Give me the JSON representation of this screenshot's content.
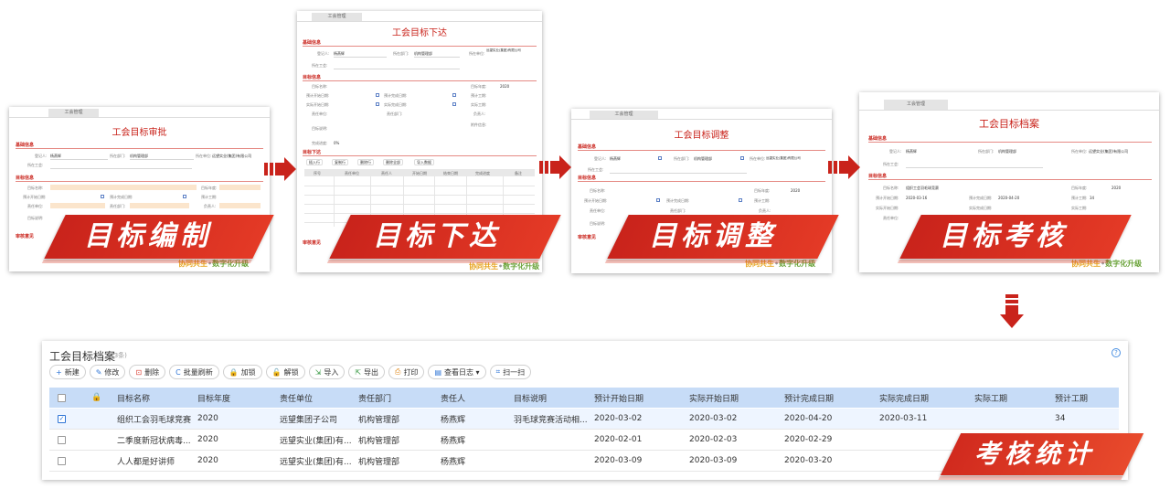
{
  "flow": [
    {
      "title": "工会目标审批",
      "tab": "工会管理",
      "sections": [
        "基础信息",
        "目标信息",
        "审核意见"
      ],
      "fields": [
        {
          "label": "登记人:",
          "value": "杨燕辉"
        },
        {
          "label": "所在部门:",
          "value": "机构管理部"
        },
        {
          "label": "所在单位:",
          "value": "远望实业(集团)有限公司"
        },
        {
          "label": "所在工会:",
          "value": ""
        },
        {
          "label": "目标名称:",
          "value": ""
        },
        {
          "label": "目标年度:",
          "value": ""
        },
        {
          "label": "预计开始日期:",
          "value": ""
        },
        {
          "label": "预计完成日期:",
          "value": ""
        },
        {
          "label": "预计工期:",
          "value": ""
        },
        {
          "label": "责任单位:",
          "value": ""
        },
        {
          "label": "责任部门:",
          "value": ""
        },
        {
          "label": "负责人:",
          "value": ""
        },
        {
          "label": "目标说明:",
          "value": ""
        }
      ],
      "banner": "目标编制"
    },
    {
      "title": "工会目标下达",
      "tab": "工会管理",
      "sections": [
        "基础信息",
        "目标信息",
        "目标下达",
        "审核意见"
      ],
      "fields": [
        {
          "label": "登记人:",
          "value": "杨燕辉"
        },
        {
          "label": "所在部门:",
          "value": "机构管理部"
        },
        {
          "label": "所在单位:",
          "value": "远望实业(集团)有限公司"
        },
        {
          "label": "所在工会:",
          "value": ""
        },
        {
          "label": "目标名称:",
          "value": ""
        },
        {
          "label": "目标年度:",
          "value": "2020"
        },
        {
          "label": "预计开始日期:",
          "value": ""
        },
        {
          "label": "预计完成日期:",
          "value": ""
        },
        {
          "label": "预计工期:",
          "value": ""
        },
        {
          "label": "实际开始日期:",
          "value": ""
        },
        {
          "label": "实际完成日期:",
          "value": ""
        },
        {
          "label": "实际工期:",
          "value": ""
        },
        {
          "label": "责任单位:",
          "value": ""
        },
        {
          "label": "责任部门:",
          "value": ""
        },
        {
          "label": "负责人:",
          "value": ""
        },
        {
          "label": "目标说明:",
          "value": ""
        },
        {
          "label": "附件信息:",
          "value": ""
        },
        {
          "label": "完成进度:",
          "value": "0%"
        }
      ],
      "subtable_buttons": [
        "插入行",
        "复制行",
        "删除行",
        "删除全部",
        "导入数据"
      ],
      "subtable_headers": [
        "序号",
        "责任单位",
        "责任人",
        "开始日期",
        "结束日期",
        "完成进度",
        "备注"
      ],
      "banner": "目标下达"
    },
    {
      "title": "工会目标调整",
      "tab": "工会管理",
      "sections": [
        "基础信息",
        "目标信息",
        "审核意见"
      ],
      "fields": [
        {
          "label": "登记人:",
          "value": "杨燕辉"
        },
        {
          "label": "所在部门:",
          "value": "机构管理部"
        },
        {
          "label": "所在单位:",
          "value": "远望实业(集团)有限公司"
        },
        {
          "label": "所在工会:",
          "value": ""
        },
        {
          "label": "目标名称:",
          "value": ""
        },
        {
          "label": "目标年度:",
          "value": "2020"
        },
        {
          "label": "预计开始日期:",
          "value": ""
        },
        {
          "label": "预计完成日期:",
          "value": ""
        },
        {
          "label": "预计工期:",
          "value": ""
        },
        {
          "label": "责任单位:",
          "value": ""
        },
        {
          "label": "责任部门:",
          "value": ""
        },
        {
          "label": "负责人:",
          "value": ""
        },
        {
          "label": "目标说明:",
          "value": ""
        }
      ],
      "banner": "目标调整"
    },
    {
      "title": "工会目标档案",
      "tab": "工会管理",
      "sections": [
        "基础信息",
        "目标信息"
      ],
      "fields": [
        {
          "label": "登记人:",
          "value": "杨燕辉"
        },
        {
          "label": "所在部门:",
          "value": "机构管理部"
        },
        {
          "label": "所在单位:",
          "value": "远望实业(集团)有限公司"
        },
        {
          "label": "所在工会:",
          "value": ""
        },
        {
          "label": "目标名称:",
          "value": "组织工会羽毛球竞赛"
        },
        {
          "label": "目标年度:",
          "value": "2020"
        },
        {
          "label": "预计开始日期:",
          "value": "2020-03-16"
        },
        {
          "label": "预计完成日期:",
          "value": "2020-04-20"
        },
        {
          "label": "预计工期:",
          "value": "34"
        },
        {
          "label": "实际开始日期:",
          "value": ""
        },
        {
          "label": "实际完成日期:",
          "value": ""
        },
        {
          "label": "实际工期:",
          "value": ""
        },
        {
          "label": "责任单位:",
          "value": ""
        },
        {
          "label": "责任部门:",
          "value": ""
        },
        {
          "label": "负责人:",
          "value": ""
        }
      ],
      "banner": "目标考核"
    }
  ],
  "slogan": {
    "part1": "协同共生",
    "sep": "•",
    "part2": "数字化升级"
  },
  "archive": {
    "title": "工会目标档案",
    "count": "(3条)",
    "help": "?",
    "toolbar": [
      {
        "icon": "+",
        "label": "新建"
      },
      {
        "icon": "✎",
        "label": "修改"
      },
      {
        "icon": "⊡",
        "label": "删除"
      },
      {
        "icon": "C",
        "label": "批量刷新"
      },
      {
        "icon": "🔒",
        "label": "加锁"
      },
      {
        "icon": "🔓",
        "label": "解锁"
      },
      {
        "icon": "⇲",
        "label": "导入"
      },
      {
        "icon": "⇱",
        "label": "导出"
      },
      {
        "icon": "⎙",
        "label": "打印"
      },
      {
        "icon": "▤",
        "label": "查看日志 ▾"
      },
      {
        "icon": "⌗",
        "label": "扫一扫"
      }
    ],
    "columns": [
      "",
      "",
      "目标名称",
      "目标年度",
      "责任单位",
      "责任部门",
      "责任人",
      "目标说明",
      "预计开始日期",
      "实际开始日期",
      "预计完成日期",
      "实际完成日期",
      "实际工期",
      "预计工期"
    ],
    "rows": [
      {
        "checked": true,
        "name": "组织工会羽毛球竞赛",
        "year": "2020",
        "unit": "远望集团子公司",
        "dept": "机构管理部",
        "owner": "杨燕辉",
        "desc": "羽毛球竞赛活动相...",
        "plan_start": "2020-03-02",
        "actual_start": "2020-03-02",
        "plan_end": "2020-04-20",
        "actual_end": "2020-03-11",
        "actual_days": "",
        "plan_days": "34"
      },
      {
        "checked": false,
        "name": "二季度新冠状病毒...",
        "year": "2020",
        "unit": "远望实业(集团)有...",
        "dept": "机构管理部",
        "owner": "杨燕辉",
        "desc": "",
        "plan_start": "2020-02-01",
        "actual_start": "2020-02-03",
        "plan_end": "2020-02-29",
        "actual_end": "",
        "actual_days": "",
        "plan_days": ""
      },
      {
        "checked": false,
        "name": "人人都是好讲师",
        "year": "2020",
        "unit": "远望实业(集团)有...",
        "dept": "机构管理部",
        "owner": "杨燕辉",
        "desc": "",
        "plan_start": "2020-03-09",
        "actual_start": "2020-03-09",
        "plan_end": "2020-03-20",
        "actual_end": "",
        "actual_days": "",
        "plan_days": ""
      }
    ],
    "banner": "考核统计"
  },
  "colors": {
    "brand_red": "#c9231b",
    "header_blue": "#c7dcf7",
    "accent_blue": "#2f75d6"
  }
}
